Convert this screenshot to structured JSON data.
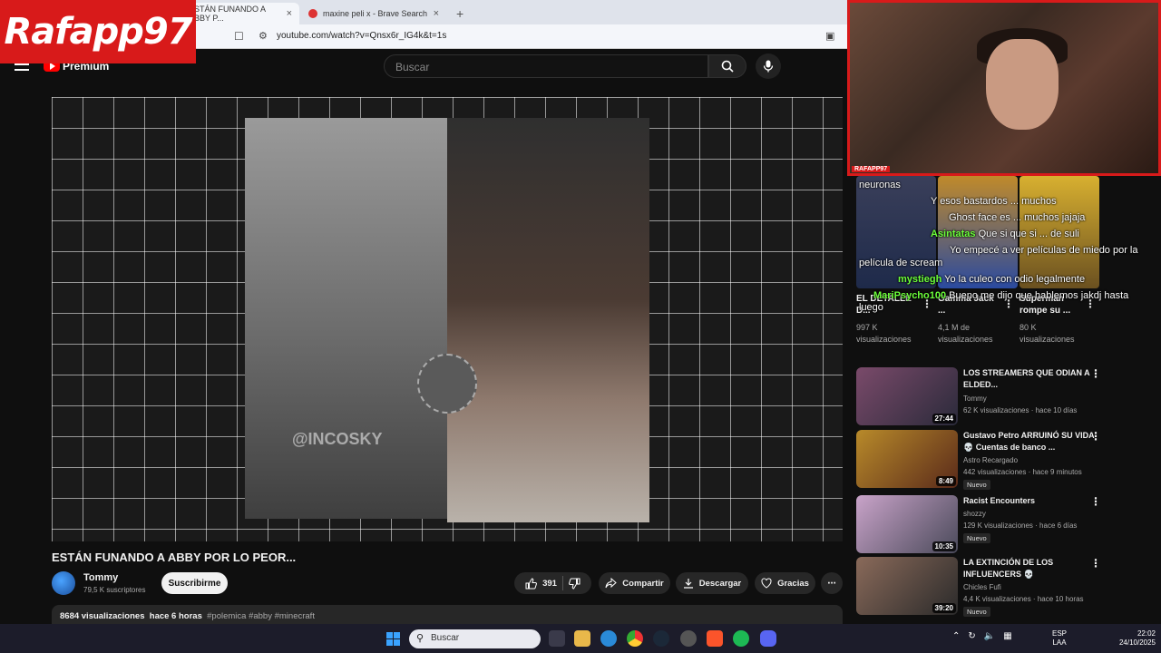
{
  "browser": {
    "tabs": [
      {
        "label": "ESTÁN FUNANDO A ABBY P...",
        "close": "×"
      },
      {
        "label": "maxine peli x - Brave Search",
        "close": "×"
      }
    ],
    "new_tab": "+",
    "url": "youtube.com/watch?v=Qnsx6r_IG4k&t=1s"
  },
  "overlay": {
    "logo": "Rafapp97",
    "cam_label": "RAFAPP97"
  },
  "youtube": {
    "brand": "Premium",
    "search_placeholder": "Buscar",
    "video": {
      "watermark": "@INCOSKY",
      "title": "ESTÁN FUNANDO A ABBY POR LO PEOR...",
      "channel": "Tommy",
      "subscribers": "79,5 K suscriptores",
      "subscribe_label": "Suscribirme",
      "likes": "391",
      "share_label": "Compartir",
      "download_label": "Descargar",
      "thanks_label": "Gracias",
      "views": "8684 visualizaciones",
      "age": "hace 6 horas",
      "tags": "#polemica #abby #minecraft"
    },
    "shorts": [
      {
        "title": "EL DETALLE D...",
        "views": "997 K visualizaciones"
      },
      {
        "title": "Gamma Jack ...",
        "views": "4,1 M de visualizaciones"
      },
      {
        "title": "Superman rompe su ...",
        "views": "80 K visualizaciones"
      }
    ],
    "recommendations": [
      {
        "title": "LOS STREAMERS QUE ODIAN A ELDED...",
        "channel": "Tommy",
        "meta": "62 K visualizaciones · hace 10 días",
        "duration": "27:44",
        "badge": "",
        "color": "#7a4a6a"
      },
      {
        "title": "Gustavo Petro ARRUINÓ SU VIDA 💀 Cuentas de banco ...",
        "channel": "Astro Recargado",
        "meta": "442 visualizaciones · hace 9 minutos",
        "duration": "8:49",
        "badge": "Nuevo",
        "color": "#b88a2a"
      },
      {
        "title": "Racist Encounters",
        "channel": "shozzy",
        "meta": "129 K visualizaciones · hace 6 días",
        "duration": "10:35",
        "badge": "Nuevo",
        "color": "#c9a3c9"
      },
      {
        "title": "LA EXTINCIÓN DE LOS INFLUENCERS 💀",
        "channel": "Chicles Fufi",
        "meta": "4,4 K visualizaciones · hace 10 horas",
        "duration": "39:20",
        "badge": "Nuevo",
        "color": "#8a6a5a"
      }
    ]
  },
  "chat": [
    {
      "user": "",
      "text": "neuronas"
    },
    {
      "user": "",
      "text": "Y esos bastardos ... muchos"
    },
    {
      "user": "",
      "text": "Ghost face es ... muchos jajaja"
    },
    {
      "user": "Asintatas",
      "text": "Que si que si ... de suli"
    },
    {
      "user": "",
      "text": "Yo empecé a ver películas de miedo por la"
    },
    {
      "user": "",
      "text": "película de scream"
    },
    {
      "user": "mystiegh",
      "text": "Yo la culeo con odio legalmente"
    },
    {
      "user": "MariPsycho100",
      "text": "Bueno me dijo que hablemos jakdj hasta"
    },
    {
      "user": "",
      "text": "luego"
    }
  ],
  "taskbar": {
    "search_placeholder": "Buscar",
    "lang_1": "ESP",
    "lang_2": "LAA",
    "time": "22:02",
    "date": "24/10/2025"
  },
  "colors": {
    "accent_red": "#d81a1a",
    "yt_red": "#ff0000",
    "chat_user": "#6cff3a"
  }
}
